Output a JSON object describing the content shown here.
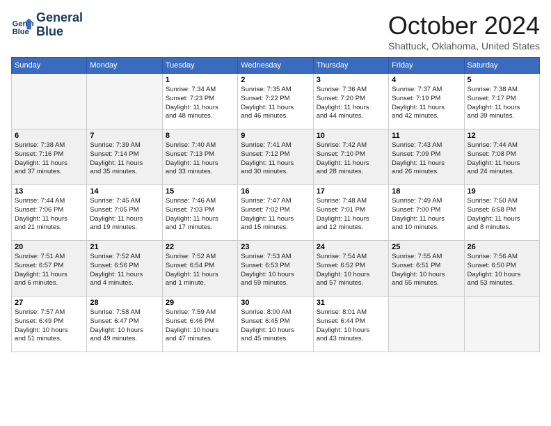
{
  "logo": {
    "line1": "General",
    "line2": "Blue"
  },
  "title": "October 2024",
  "location": "Shattuck, Oklahoma, United States",
  "days_of_week": [
    "Sunday",
    "Monday",
    "Tuesday",
    "Wednesday",
    "Thursday",
    "Friday",
    "Saturday"
  ],
  "weeks": [
    [
      {
        "day": "",
        "info": ""
      },
      {
        "day": "",
        "info": ""
      },
      {
        "day": "1",
        "info": "Sunrise: 7:34 AM\nSunset: 7:23 PM\nDaylight: 11 hours\nand 48 minutes."
      },
      {
        "day": "2",
        "info": "Sunrise: 7:35 AM\nSunset: 7:22 PM\nDaylight: 11 hours\nand 46 minutes."
      },
      {
        "day": "3",
        "info": "Sunrise: 7:36 AM\nSunset: 7:20 PM\nDaylight: 11 hours\nand 44 minutes."
      },
      {
        "day": "4",
        "info": "Sunrise: 7:37 AM\nSunset: 7:19 PM\nDaylight: 11 hours\nand 42 minutes."
      },
      {
        "day": "5",
        "info": "Sunrise: 7:38 AM\nSunset: 7:17 PM\nDaylight: 11 hours\nand 39 minutes."
      }
    ],
    [
      {
        "day": "6",
        "info": "Sunrise: 7:38 AM\nSunset: 7:16 PM\nDaylight: 11 hours\nand 37 minutes."
      },
      {
        "day": "7",
        "info": "Sunrise: 7:39 AM\nSunset: 7:14 PM\nDaylight: 11 hours\nand 35 minutes."
      },
      {
        "day": "8",
        "info": "Sunrise: 7:40 AM\nSunset: 7:13 PM\nDaylight: 11 hours\nand 33 minutes."
      },
      {
        "day": "9",
        "info": "Sunrise: 7:41 AM\nSunset: 7:12 PM\nDaylight: 11 hours\nand 30 minutes."
      },
      {
        "day": "10",
        "info": "Sunrise: 7:42 AM\nSunset: 7:10 PM\nDaylight: 11 hours\nand 28 minutes."
      },
      {
        "day": "11",
        "info": "Sunrise: 7:43 AM\nSunset: 7:09 PM\nDaylight: 11 hours\nand 26 minutes."
      },
      {
        "day": "12",
        "info": "Sunrise: 7:44 AM\nSunset: 7:08 PM\nDaylight: 11 hours\nand 24 minutes."
      }
    ],
    [
      {
        "day": "13",
        "info": "Sunrise: 7:44 AM\nSunset: 7:06 PM\nDaylight: 11 hours\nand 21 minutes."
      },
      {
        "day": "14",
        "info": "Sunrise: 7:45 AM\nSunset: 7:05 PM\nDaylight: 11 hours\nand 19 minutes."
      },
      {
        "day": "15",
        "info": "Sunrise: 7:46 AM\nSunset: 7:03 PM\nDaylight: 11 hours\nand 17 minutes."
      },
      {
        "day": "16",
        "info": "Sunrise: 7:47 AM\nSunset: 7:02 PM\nDaylight: 11 hours\nand 15 minutes."
      },
      {
        "day": "17",
        "info": "Sunrise: 7:48 AM\nSunset: 7:01 PM\nDaylight: 11 hours\nand 12 minutes."
      },
      {
        "day": "18",
        "info": "Sunrise: 7:49 AM\nSunset: 7:00 PM\nDaylight: 11 hours\nand 10 minutes."
      },
      {
        "day": "19",
        "info": "Sunrise: 7:50 AM\nSunset: 6:58 PM\nDaylight: 11 hours\nand 8 minutes."
      }
    ],
    [
      {
        "day": "20",
        "info": "Sunrise: 7:51 AM\nSunset: 6:57 PM\nDaylight: 11 hours\nand 6 minutes."
      },
      {
        "day": "21",
        "info": "Sunrise: 7:52 AM\nSunset: 6:56 PM\nDaylight: 11 hours\nand 4 minutes."
      },
      {
        "day": "22",
        "info": "Sunrise: 7:52 AM\nSunset: 6:54 PM\nDaylight: 11 hours\nand 1 minute."
      },
      {
        "day": "23",
        "info": "Sunrise: 7:53 AM\nSunset: 6:53 PM\nDaylight: 10 hours\nand 59 minutes."
      },
      {
        "day": "24",
        "info": "Sunrise: 7:54 AM\nSunset: 6:52 PM\nDaylight: 10 hours\nand 57 minutes."
      },
      {
        "day": "25",
        "info": "Sunrise: 7:55 AM\nSunset: 6:51 PM\nDaylight: 10 hours\nand 55 minutes."
      },
      {
        "day": "26",
        "info": "Sunrise: 7:56 AM\nSunset: 6:50 PM\nDaylight: 10 hours\nand 53 minutes."
      }
    ],
    [
      {
        "day": "27",
        "info": "Sunrise: 7:57 AM\nSunset: 6:49 PM\nDaylight: 10 hours\nand 51 minutes."
      },
      {
        "day": "28",
        "info": "Sunrise: 7:58 AM\nSunset: 6:47 PM\nDaylight: 10 hours\nand 49 minutes."
      },
      {
        "day": "29",
        "info": "Sunrise: 7:59 AM\nSunset: 6:46 PM\nDaylight: 10 hours\nand 47 minutes."
      },
      {
        "day": "30",
        "info": "Sunrise: 8:00 AM\nSunset: 6:45 PM\nDaylight: 10 hours\nand 45 minutes."
      },
      {
        "day": "31",
        "info": "Sunrise: 8:01 AM\nSunset: 6:44 PM\nDaylight: 10 hours\nand 43 minutes."
      },
      {
        "day": "",
        "info": ""
      },
      {
        "day": "",
        "info": ""
      }
    ]
  ]
}
